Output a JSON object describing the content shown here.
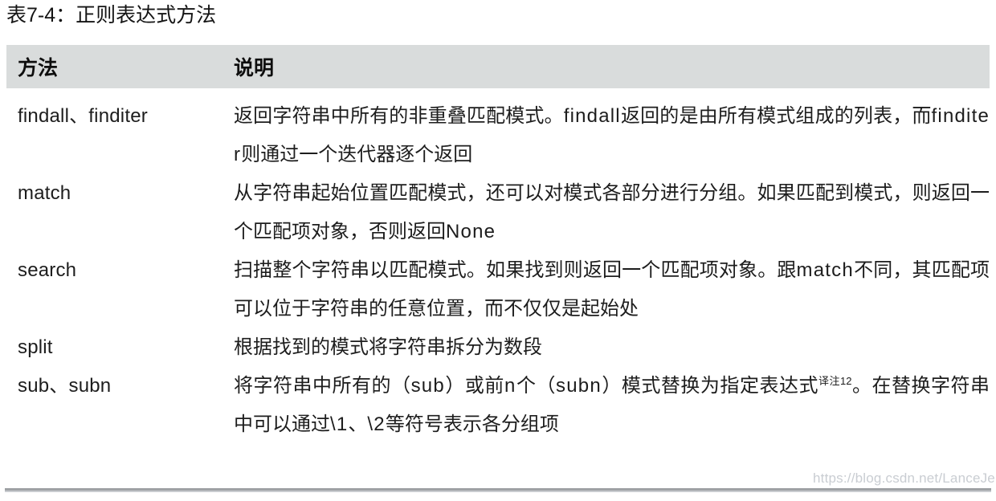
{
  "caption": "表7-4：正则表达式方法",
  "table": {
    "columns": [
      {
        "key": "method",
        "header": "方法"
      },
      {
        "key": "description",
        "header": "说明"
      }
    ],
    "rows": [
      {
        "method": "findall、finditer",
        "description_parts": [
          {
            "t": "返回字符串中所有的非重叠匹配模式。"
          },
          {
            "t": "findall",
            "latin": true
          },
          {
            "t": "返回的是由所有模式组成的列表，而"
          },
          {
            "t": "finditer",
            "latin": true
          },
          {
            "t": "则通过一个迭代器逐个返回"
          }
        ],
        "description": "返回字符串中所有的非重叠匹配模式。findall返回的是由所有模式组成的列表，而finditer则通过一个迭代器逐个返回"
      },
      {
        "method": "match",
        "description_parts": [
          {
            "t": "从字符串起始位置匹配模式，还可以对模式各部分进行分组。如果匹配到模式，则返回一个匹配项对象，否则返回"
          },
          {
            "t": "None",
            "latin": true
          }
        ],
        "description": "从字符串起始位置匹配模式，还可以对模式各部分进行分组。如果匹配到模式，则返回一个匹配项对象，否则返回None"
      },
      {
        "method": "search",
        "description_parts": [
          {
            "t": "扫描整个字符串以匹配模式。如果找到则返回一个匹配项对象。跟"
          },
          {
            "t": "match",
            "latin": true
          },
          {
            "t": "不同，其匹配项可以位于字符串的任意位置，而不仅仅是起始处"
          }
        ],
        "description": "扫描整个字符串以匹配模式。如果找到则返回一个匹配项对象。跟match不同，其匹配项可以位于字符串的任意位置，而不仅仅是起始处"
      },
      {
        "method": "split",
        "description_parts": [
          {
            "t": "根据找到的模式将字符串拆分为数段"
          }
        ],
        "description": "根据找到的模式将字符串拆分为数段"
      },
      {
        "method": "sub、subn",
        "description_parts": [
          {
            "t": "将字符串中所有的（"
          },
          {
            "t": "sub",
            "latin": true
          },
          {
            "t": "）或前"
          },
          {
            "t": "n",
            "latin": true
          },
          {
            "t": "个（"
          },
          {
            "t": "subn",
            "latin": true
          },
          {
            "t": "）模式替换为指定表达式"
          },
          {
            "t": "译注12",
            "sup": true
          },
          {
            "t": "。在替换字符串中可以通过"
          },
          {
            "t": "\\1",
            "latin": true
          },
          {
            "t": "、"
          },
          {
            "t": "\\2",
            "latin": true
          },
          {
            "t": "等符号表示各分组项"
          }
        ],
        "description": "将字符串中所有的（sub）或前n个（subn）模式替换为指定表达式译注12。在替换字符串中可以通过\\1、\\2等符号表示各分组项"
      }
    ]
  },
  "watermark": "https://blog.csdn.net/LanceJerry",
  "colors": {
    "header_background": "#d9dcdc",
    "page_background": "#ffffff",
    "text": "#1d1d1d",
    "rule": "#8d9094",
    "watermark": "#c9cdd2"
  }
}
